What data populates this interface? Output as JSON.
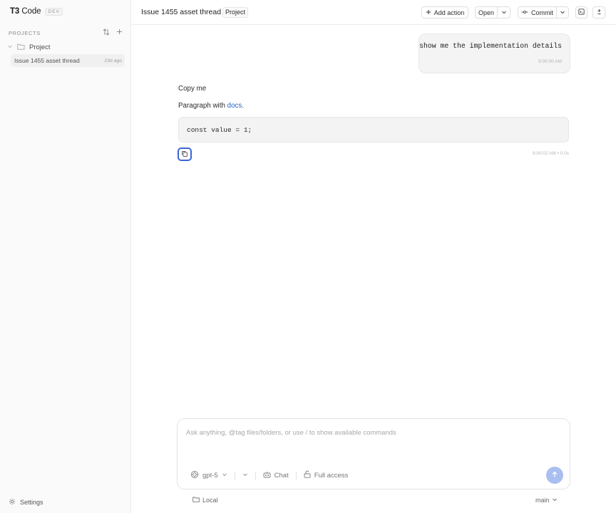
{
  "app": {
    "brand_bold": "T3",
    "brand_rest": " Code",
    "badge": "DEV"
  },
  "sidebar": {
    "projects_label": "PROJECTS",
    "project_name": "Project",
    "threads": [
      {
        "title": "Issue 1455 asset thread",
        "age": "23d ago"
      }
    ],
    "settings_label": "Settings"
  },
  "topbar": {
    "thread_title": "Issue 1455 asset thread",
    "project_chip": "Project",
    "add_action_label": "Add action",
    "open_label": "Open",
    "commit_label": "Commit"
  },
  "conversation": {
    "user_message": {
      "text": "show me the implementation details",
      "time": "9:00:00 AM"
    },
    "assistant_message": {
      "line1": "Copy me",
      "paragraph_prefix": "Paragraph with ",
      "link_text": "docs",
      "paragraph_suffix": ".",
      "code": "const value = 1;",
      "meta": "9:00:02 AM • 0.0s"
    }
  },
  "composer": {
    "placeholder": "Ask anything, @tag files/folders, or use / to show available commands",
    "model": "gpt-5",
    "mode": "Chat",
    "access": "Full access"
  },
  "footer": {
    "location": "Local",
    "branch": "main"
  },
  "colors": {
    "accent": "#3b64d6",
    "link": "#2563c9",
    "send_button": "#a9bff0"
  }
}
